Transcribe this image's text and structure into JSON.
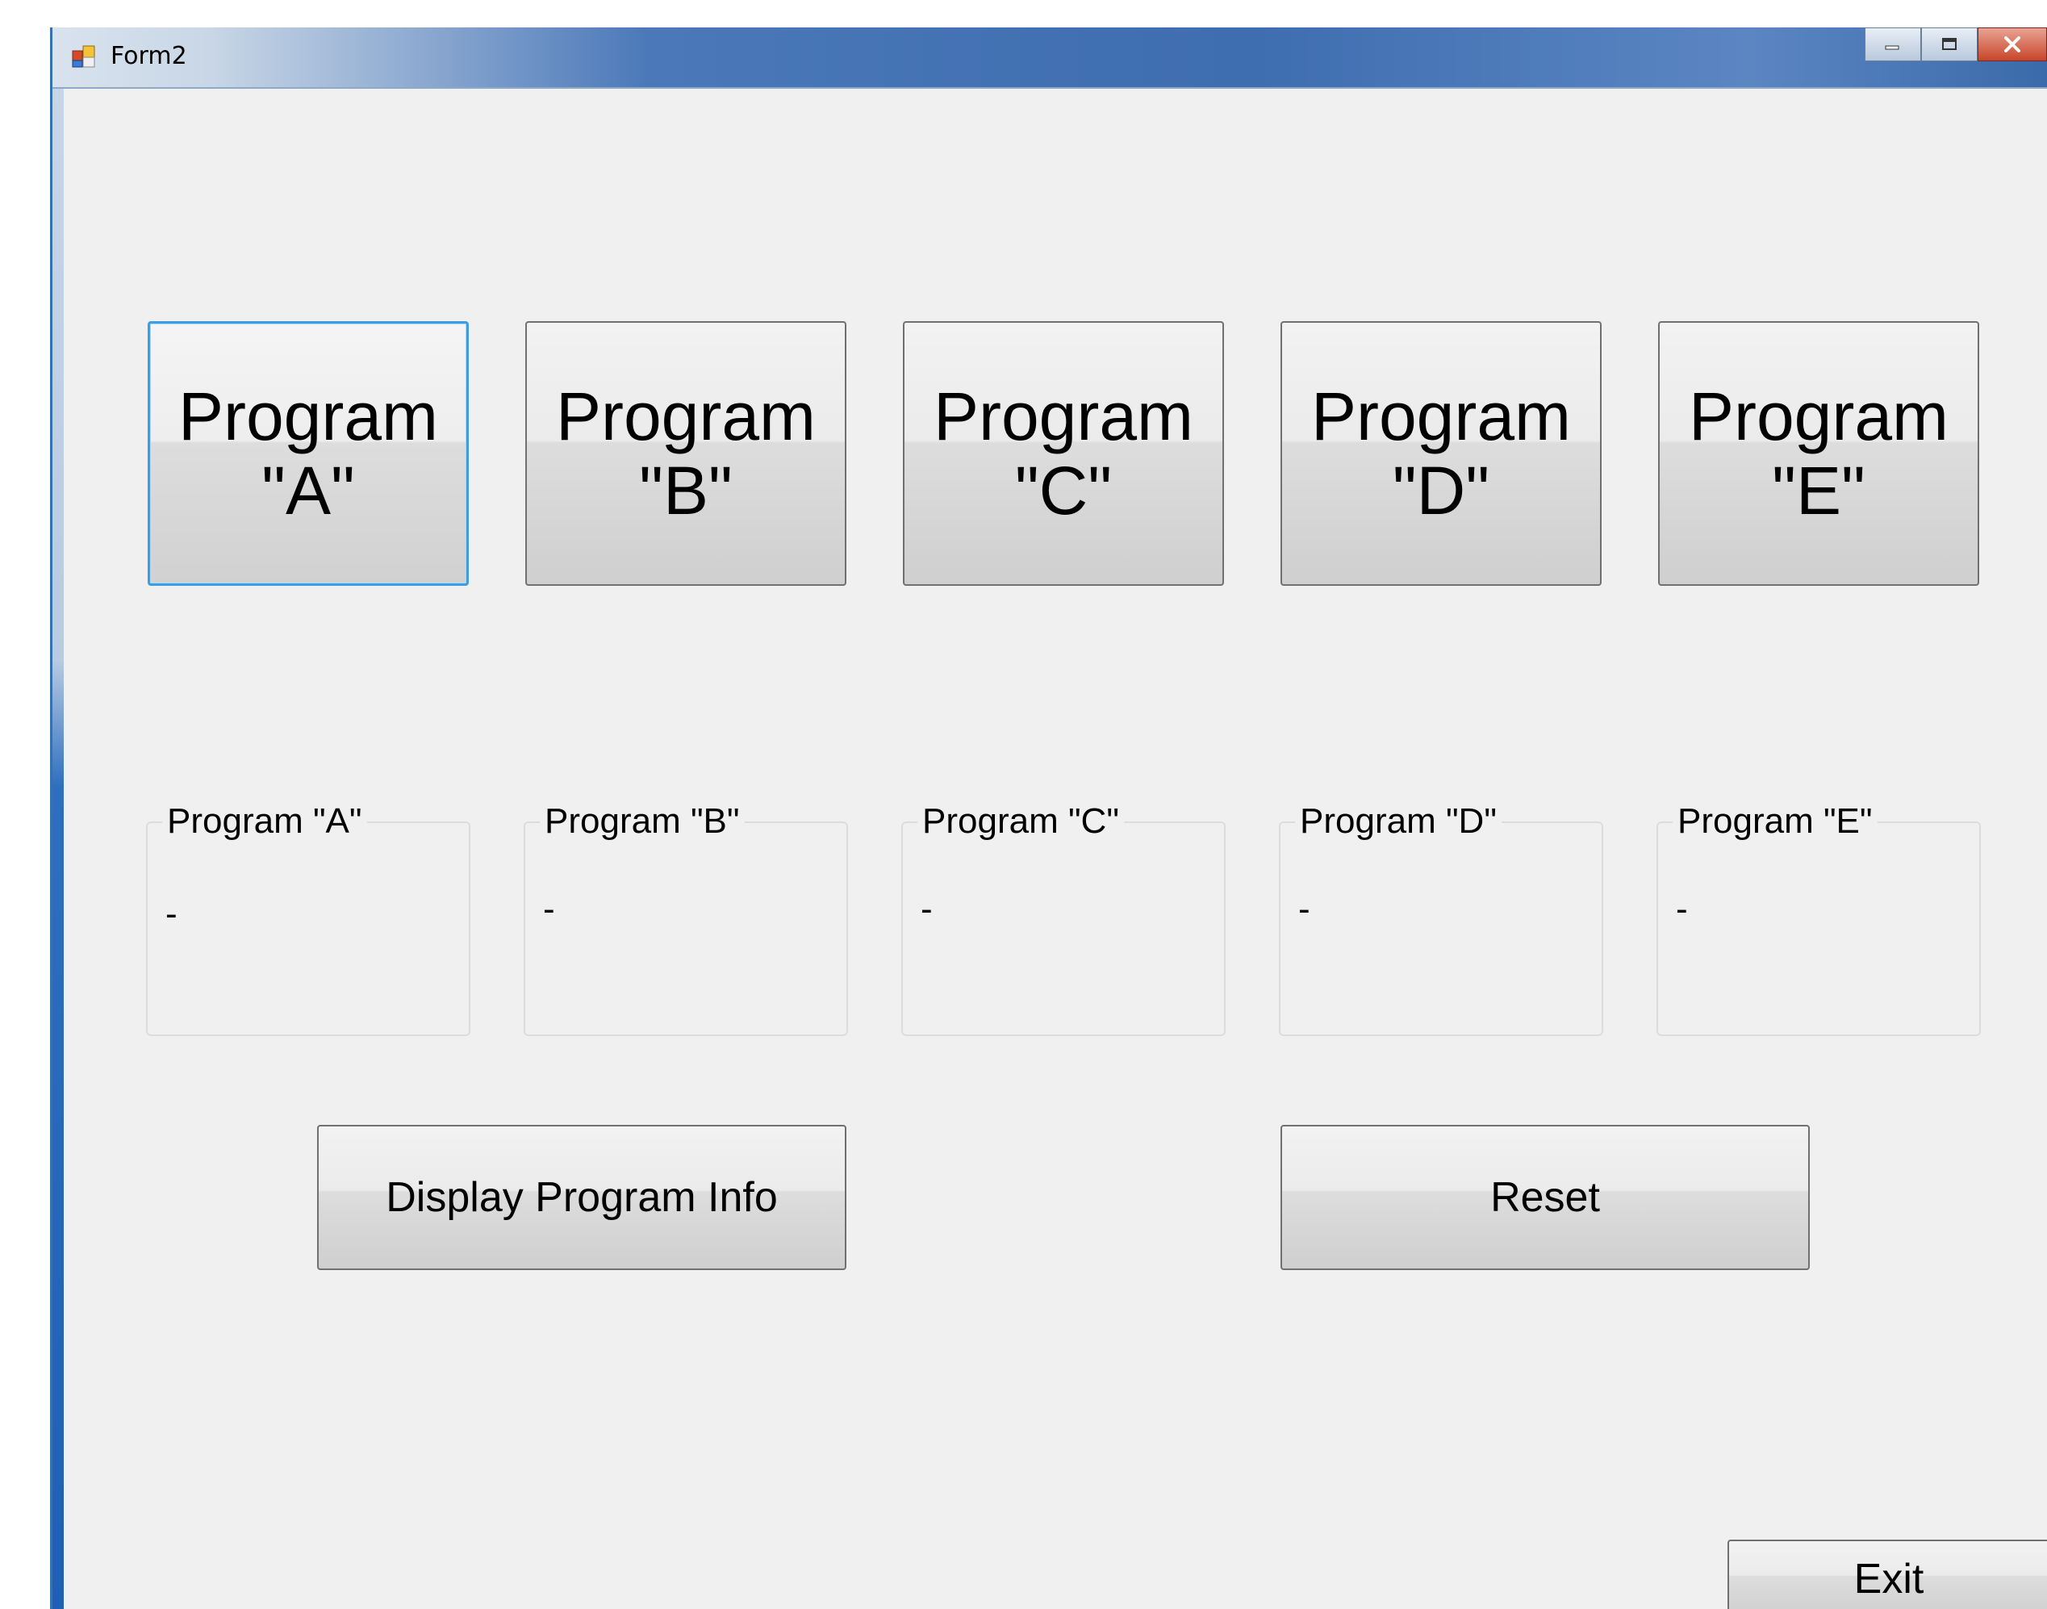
{
  "window": {
    "title": "Form2"
  },
  "program_buttons": [
    {
      "label": "Program\n\"A\""
    },
    {
      "label": "Program\n\"B\""
    },
    {
      "label": "Program\n\"C\""
    },
    {
      "label": "Program\n\"D\""
    },
    {
      "label": "Program\n\"E\""
    }
  ],
  "groups": [
    {
      "label": "Program \"A\"",
      "value": "-"
    },
    {
      "label": "Program \"B\"",
      "value": "-"
    },
    {
      "label": "Program \"C\"",
      "value": "-"
    },
    {
      "label": "Program \"D\"",
      "value": "-"
    },
    {
      "label": "Program \"E\"",
      "value": "-"
    }
  ],
  "actions": {
    "display_label": "Display Program Info",
    "reset_label": "Reset",
    "exit_label": "Exit"
  }
}
